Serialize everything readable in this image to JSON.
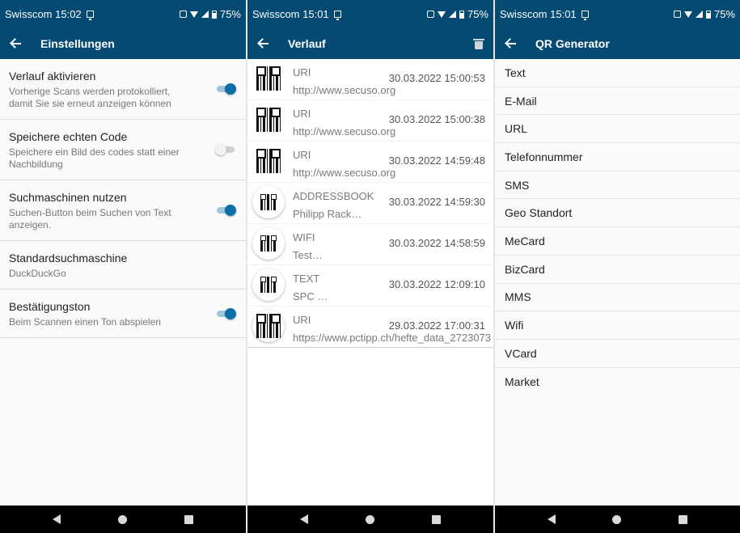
{
  "screens": [
    {
      "status": {
        "carrier": "Swisscom 15:02",
        "battery": "75%"
      },
      "appbar": {
        "title": "Einstellungen"
      },
      "settings": [
        {
          "title": "Verlauf aktivieren",
          "summary": "Vorherige Scans werden protokolliert, damit Sie sie erneut anzeigen können",
          "toggle": "on"
        },
        {
          "title": "Speichere echten Code",
          "summary": "Speichere ein Bild des codes statt einer Nachbildung",
          "toggle": "off"
        },
        {
          "title": "Suchmaschinen nutzen",
          "summary": "Suchen-Button beim Suchen von Text anzeigen.",
          "toggle": "on"
        },
        {
          "title": "Standardsuchmaschine",
          "summary": "DuckDuckGo"
        },
        {
          "title": "Bestätigungston",
          "summary": "Beim Scannen einen Ton abspielen",
          "toggle": "on"
        }
      ]
    },
    {
      "status": {
        "carrier": "Swisscom 15:01",
        "battery": "75%"
      },
      "appbar": {
        "title": "Verlauf"
      },
      "history": [
        {
          "type": "URI",
          "date": "30.03.2022 15:00:53",
          "content": "http://www.secuso.org",
          "icon": "qr-code-icon"
        },
        {
          "type": "URI",
          "date": "30.03.2022 15:00:38",
          "content": "http://www.secuso.org",
          "icon": "qr-code-icon"
        },
        {
          "type": "URI",
          "date": "30.03.2022 14:59:48",
          "content": "http://www.secuso.org",
          "icon": "qr-code-icon"
        },
        {
          "type": "ADDRESSBOOK",
          "date": "30.03.2022 14:59:30",
          "content": "Philipp Rack…",
          "icon": "qr-code-icon"
        },
        {
          "type": "WIFI",
          "date": "30.03.2022 14:58:59",
          "content": "Test…",
          "icon": "qr-code-icon"
        },
        {
          "type": "TEXT",
          "date": "30.03.2022 12:09:10",
          "content": "SPC …",
          "icon": "qr-code-icon"
        },
        {
          "type": "URI",
          "date": "29.03.2022 17:00:31",
          "content": "https://www.pctipp.ch/hefte_data_2723073",
          "icon": "qr-code-icon"
        }
      ]
    },
    {
      "status": {
        "carrier": "Swisscom 15:01",
        "battery": "75%"
      },
      "appbar": {
        "title": "QR Generator"
      },
      "generators": [
        "Text",
        "E-Mail",
        "URL",
        "Telefonnummer",
        "SMS",
        "Geo Standort",
        "MeCard",
        "BizCard",
        "MMS",
        "Wifi",
        "VCard",
        "Market"
      ]
    }
  ],
  "colors": {
    "primary": "#044a73",
    "accent": "#0f6ea8"
  }
}
